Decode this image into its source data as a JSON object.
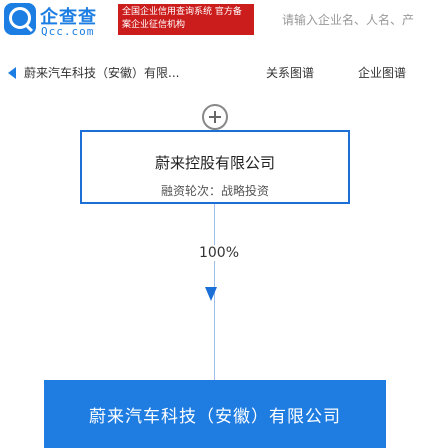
{
  "header": {
    "logo_cn": "企查查",
    "logo_en": "Qcc.com",
    "slogan": "全国企业信用查询系统 官方备案企业征信机构",
    "search_placeholder": "请输入企业名、人名、产"
  },
  "nav": {
    "back_label": "蔚来汽车科技（安徽）有限...",
    "tab_relation": "关系图谱",
    "tab_enterprise_graph": "企业图谱"
  },
  "graph": {
    "parent": {
      "name": "蔚来控股有限公司",
      "funding_round": "融资轮次：战略投资"
    },
    "edge_percent": "100%",
    "target": {
      "name": "蔚来汽车科技（安徽）有限公司"
    }
  },
  "colors": {
    "brand_blue": "#1c7ee2",
    "slogan_red": "#cc1d1d",
    "node_border": "#1c6fd6",
    "target_fill": "#1f7de2"
  },
  "icons": {
    "logo": "qcc-logo-icon",
    "back": "back-arrow-icon",
    "expand": "expand-plus-icon",
    "edge_arrow": "arrow-down-icon"
  }
}
